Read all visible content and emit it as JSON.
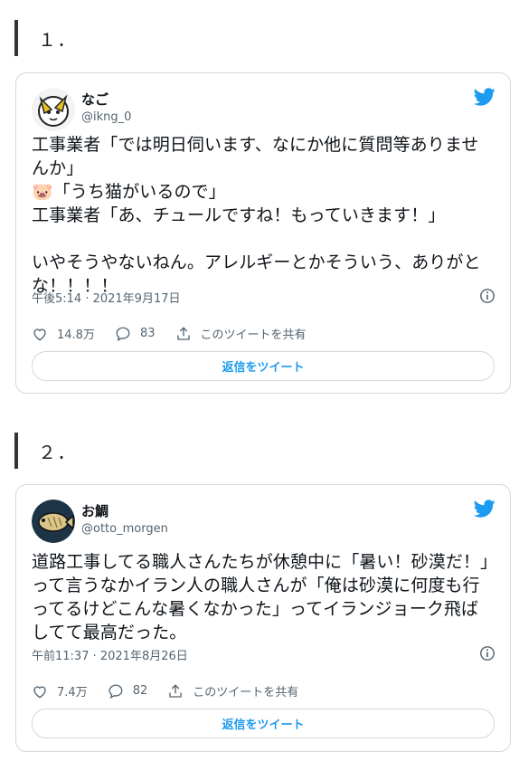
{
  "sections": [
    {
      "number": "１.",
      "tweet": {
        "name": "なご",
        "handle": "@ikng_0",
        "text": "工事業者「では明日伺います、なにか他に質問等ありませんか」\n🐷「うち猫がいるので」\n工事業者「あ、チュールですね！もっていきます！」\n\nいやそうやないねん。アレルギーとかそういう、ありがとな！！！！",
        "timestamp": "午後5:14 · 2021年9月17日",
        "likes": "14.8万",
        "replies": "83",
        "share_label": "このツイートを共有",
        "reply_button": "返信をツイート"
      }
    },
    {
      "number": "２.",
      "tweet": {
        "name": "お鯛",
        "handle": "@otto_morgen",
        "text": "道路工事してる職人さんたちが休憩中に「暑い！砂漠だ！」って言うなかイラン人の職人さんが「俺は砂漠に何度も行ってるけどこんな暑くなかった」ってイランジョーク飛ばしてて最高だった。",
        "timestamp": "午前11:37 · 2021年8月26日",
        "likes": "7.4万",
        "replies": "82",
        "share_label": "このツイートを共有",
        "reply_button": "返信をツイート"
      }
    }
  ],
  "colors": {
    "accent": "#1d9bf0",
    "muted": "#536471",
    "border": "#cfd9de"
  }
}
